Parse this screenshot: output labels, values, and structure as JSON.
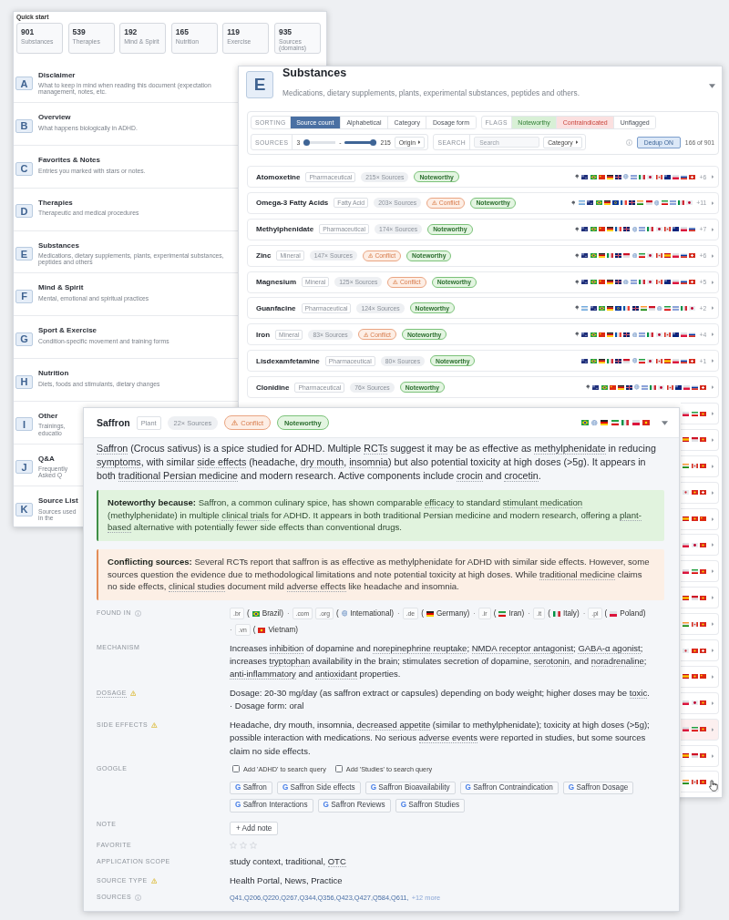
{
  "overview_window": {
    "quick_start": {
      "title": "Quick start",
      "stats": [
        {
          "value": "901",
          "label": "Substances"
        },
        {
          "value": "539",
          "label": "Therapies"
        },
        {
          "value": "192",
          "label": "Mind & Spirit"
        },
        {
          "value": "165",
          "label": "Nutrition"
        },
        {
          "value": "119",
          "label": "Exercise"
        },
        {
          "value": "935",
          "label": "Sources (domains)"
        }
      ]
    },
    "sections": [
      {
        "letter": "A",
        "title": "Disclaimer",
        "description": "What to keep in mind when reading this document (expectation management, notes, etc."
      },
      {
        "letter": "B",
        "title": "Overview",
        "description": "What happens biologically in ADHD."
      },
      {
        "letter": "C",
        "title": "Favorites & Notes",
        "description": "Entries you marked with stars or notes."
      },
      {
        "letter": "D",
        "title": "Therapies",
        "description": "Therapeutic and medical procedures"
      },
      {
        "letter": "E",
        "title": "Substances",
        "description": "Medications, dietary supplements, plants, experimental substances, peptides and others"
      },
      {
        "letter": "F",
        "title": "Mind & Spirit",
        "description": "Mental, emotional and spiritual practices"
      },
      {
        "letter": "G",
        "title": "Sport & Exercise",
        "description": "Condition-specific movement and training forms"
      },
      {
        "letter": "H",
        "title": "Nutrition",
        "description": "Diets, foods and stimulants, dietary changes"
      },
      {
        "letter": "I",
        "title": "Other",
        "description": "Trainings, educatio"
      },
      {
        "letter": "J",
        "title": "Q&A",
        "description": "Frequently Asked Q"
      },
      {
        "letter": "K",
        "title": "Source List",
        "description": "Sources used in the"
      }
    ]
  },
  "substances_window": {
    "letter": "E",
    "title": "Substances",
    "description": "Medications, dietary supplements, plants, experimental substances, peptides and others.",
    "filters": {
      "sorting": {
        "label": "SORTING",
        "options": [
          {
            "label": "Source count",
            "selected": true
          },
          {
            "label": "Alphabetical",
            "selected": false
          },
          {
            "label": "Category",
            "selected": false
          },
          {
            "label": "Dosage form",
            "selected": false
          }
        ]
      },
      "flags": {
        "label": "FLAGS",
        "options": [
          {
            "label": "Noteworthy",
            "kind": "noteworthy"
          },
          {
            "label": "Contraindicated",
            "kind": "contraindicated"
          },
          {
            "label": "Unflagged",
            "kind": "unflagged"
          }
        ]
      },
      "sources": {
        "label": "SOURCES",
        "min": {
          "value": "3",
          "level": 0
        },
        "separator": "-",
        "max": {
          "value": "215",
          "level": 1
        },
        "origin": "Origin"
      },
      "search": {
        "label": "SEARCH",
        "placeholder": "Search",
        "category": "Category"
      },
      "dedup": {
        "label": "Dedup ON",
        "on": true
      },
      "count": "166 of 901"
    },
    "rows": [
      {
        "name": "Atomoxetine",
        "category": "Pharmaceutical",
        "sources": "215× Sources",
        "badges": [
          {
            "kind": "noteworthy",
            "label": "Noteworthy"
          }
        ],
        "pin": true,
        "more": "+6"
      },
      {
        "name": "Omega-3 Fatty Acids",
        "category": "Fatty Acid",
        "sources": "203× Sources",
        "badges": [
          {
            "kind": "conflict",
            "label": "Conflict"
          },
          {
            "kind": "noteworthy",
            "label": "Noteworthy"
          }
        ],
        "pin": true,
        "more": "+11"
      },
      {
        "name": "Methylphenidate",
        "category": "Pharmaceutical",
        "sources": "174× Sources",
        "badges": [
          {
            "kind": "noteworthy",
            "label": "Noteworthy"
          }
        ],
        "pin": true,
        "more": "+7"
      },
      {
        "name": "Zinc",
        "category": "Mineral",
        "sources": "147× Sources",
        "badges": [
          {
            "kind": "conflict",
            "label": "Conflict"
          },
          {
            "kind": "noteworthy",
            "label": "Noteworthy"
          }
        ],
        "pin": true,
        "more": "+6"
      },
      {
        "name": "Magnesium",
        "category": "Mineral",
        "sources": "125× Sources",
        "badges": [
          {
            "kind": "conflict",
            "label": "Conflict"
          },
          {
            "kind": "noteworthy",
            "label": "Noteworthy"
          }
        ],
        "pin": true,
        "more": "+5"
      },
      {
        "name": "Guanfacine",
        "category": "Pharmaceutical",
        "sources": "124× Sources",
        "badges": [
          {
            "kind": "noteworthy",
            "label": "Noteworthy"
          }
        ],
        "pin": true,
        "more": "+2"
      },
      {
        "name": "Iron",
        "category": "Mineral",
        "sources": "83× Sources",
        "badges": [
          {
            "kind": "conflict",
            "label": "Conflict"
          },
          {
            "kind": "noteworthy",
            "label": "Noteworthy"
          }
        ],
        "pin": true,
        "more": "+4"
      },
      {
        "name": "Lisdexamfetamine",
        "category": "Pharmaceutical",
        "sources": "80× Sources",
        "badges": [
          {
            "kind": "noteworthy",
            "label": "Noteworthy"
          }
        ],
        "pin": false,
        "more": "+1"
      },
      {
        "name": "Clonidine",
        "category": "Pharmaceutical",
        "sources": "76× Sources",
        "badges": [
          {
            "kind": "noteworthy",
            "label": "Noteworthy"
          }
        ],
        "pin": true
      }
    ],
    "covered_rows": [
      {
        "highlighted": false
      },
      {
        "highlighted": false
      },
      {
        "highlighted": false
      },
      {
        "highlighted": false
      },
      {
        "highlighted": false
      },
      {
        "highlighted": false
      },
      {
        "highlighted": false
      },
      {
        "highlighted": false
      },
      {
        "highlighted": false
      },
      {
        "highlighted": false
      },
      {
        "highlighted": false
      },
      {
        "highlighted": false
      },
      {
        "highlighted": true
      },
      {
        "highlighted": false
      },
      {
        "highlighted": false
      }
    ]
  },
  "detail_window": {
    "name": "Saffron",
    "category": "Plant",
    "sources": "22× Sources",
    "badges": [
      {
        "kind": "conflict",
        "label": "Conflict"
      },
      {
        "kind": "noteworthy",
        "label": "Noteworthy"
      }
    ],
    "summary": [
      {
        "text": "Saffron",
        "term": true
      },
      {
        "text": " (Crocus sativus) is a spice studied for ADHD. Multiple ",
        "term": false
      },
      {
        "text": "RCTs",
        "term": true
      },
      {
        "text": " suggest it may be as effective as ",
        "term": false
      },
      {
        "text": "methylphenidate",
        "term": true
      },
      {
        "text": " in reducing ",
        "term": false
      },
      {
        "text": "symptoms",
        "term": true
      },
      {
        "text": ", with similar ",
        "term": false
      },
      {
        "text": "side effects",
        "term": true
      },
      {
        "text": " (headache, ",
        "term": false
      },
      {
        "text": "dry mouth",
        "term": true
      },
      {
        "text": ", ",
        "term": false
      },
      {
        "text": "insomnia",
        "term": true
      },
      {
        "text": ") but also potential toxicity at high doses (>5g). It appears in both ",
        "term": false
      },
      {
        "text": "traditional Persian medicine",
        "term": true
      },
      {
        "text": " and modern research. Active components include ",
        "term": false
      },
      {
        "text": "crocin",
        "term": true
      },
      {
        "text": " and ",
        "term": false
      },
      {
        "text": "crocetin",
        "term": true
      },
      {
        "text": ".",
        "term": false
      }
    ],
    "callouts": [
      {
        "kind": "noteworthy",
        "segments": [
          {
            "text": "**Noteworthy because:** Saffron, a common culinary spice, has shown comparable ",
            "term": false
          },
          {
            "text": "efficacy",
            "term": true
          },
          {
            "text": " to standard ",
            "term": false
          },
          {
            "text": "stimulant medication",
            "term": true
          },
          {
            "text": " (methylphenidate) in multiple ",
            "term": false
          },
          {
            "text": "clinical trials",
            "term": true
          },
          {
            "text": " for ADHD. It appears in both traditional Persian medicine and modern research, offering a ",
            "term": false
          },
          {
            "text": "plant-based",
            "term": true
          },
          {
            "text": " alternative with potentially fewer side effects than conventional drugs.",
            "term": false
          }
        ]
      },
      {
        "kind": "conflict",
        "segments": [
          {
            "text": "**Conflicting sources:** Several RCTs report that saffron is as effective as methylphenidate for ADHD with similar side effects. However, some sources question the evidence due to methodological limitations and note potential toxicity at high doses. While ",
            "term": false
          },
          {
            "text": "traditional medicine",
            "term": true
          },
          {
            "text": " claims no side effects, ",
            "term": false
          },
          {
            "text": "clinical studies",
            "term": true
          },
          {
            "text": " document mild ",
            "term": false
          },
          {
            "text": "adverse effects",
            "term": true
          },
          {
            "text": " like headache and insomnia.",
            "term": false
          }
        ]
      }
    ],
    "details": [
      {
        "kind": "found_in",
        "label": "FOUND IN",
        "term": false,
        "warning": false,
        "info": true,
        "groups": [
          {
            "kind": "country",
            "domains": [
              ".br"
            ],
            "open": "(",
            "country": "Brazil",
            "close": ")"
          },
          {
            "kind": "global",
            "sep": "·",
            "domains": [
              ".com",
              ".org"
            ],
            "open": "(",
            "country": "International",
            "close": ")"
          },
          {
            "kind": "country",
            "sep": "·",
            "domains": [
              ".de"
            ],
            "open": "(",
            "country": "Germany",
            "close": ")"
          },
          {
            "kind": "country",
            "sep": "·",
            "domains": [
              ".ir"
            ],
            "open": "(",
            "country": "Iran",
            "close": ")"
          },
          {
            "kind": "country",
            "sep": "·",
            "domains": [
              ".it"
            ],
            "open": "(",
            "country": "Italy",
            "close": ")"
          },
          {
            "kind": "country",
            "sep": "·",
            "domains": [
              ".pl"
            ],
            "open": "(",
            "country": "Poland",
            "close": ")"
          },
          {
            "kind": "country",
            "sep": "·",
            "domains": [
              ".vn"
            ],
            "open": "(",
            "country": "Vietnam",
            "close": ")"
          }
        ]
      },
      {
        "kind": "text",
        "label": "MECHANISM",
        "term": false,
        "warning": false,
        "info": false,
        "segments": [
          {
            "text": "Increases ",
            "term": false
          },
          {
            "text": "inhibition",
            "term": true
          },
          {
            "text": " of dopamine and ",
            "term": false
          },
          {
            "text": "norepinephrine reuptake",
            "term": true
          },
          {
            "text": "; ",
            "term": false
          },
          {
            "text": "NMDA receptor antagonist",
            "term": true
          },
          {
            "text": "; ",
            "term": false
          },
          {
            "text": "GABA-α agonist",
            "term": true
          },
          {
            "text": "; increases ",
            "term": false
          },
          {
            "text": "tryptophan",
            "term": true
          },
          {
            "text": " availability in the brain; stimulates secretion of dopamine, ",
            "term": false
          },
          {
            "text": "serotonin",
            "term": true
          },
          {
            "text": ", and ",
            "term": false
          },
          {
            "text": "noradrenaline",
            "term": true
          },
          {
            "text": "; ",
            "term": false
          },
          {
            "text": "anti-inflammatory",
            "term": true
          },
          {
            "text": " and ",
            "term": false
          },
          {
            "text": "antioxidant",
            "term": true
          },
          {
            "text": " properties.",
            "term": false
          }
        ]
      },
      {
        "kind": "text",
        "label": "DOSAGE",
        "term": true,
        "warning": true,
        "info": false,
        "segments": [
          {
            "text": "Dosage: 20-30 mg/day (as saffron extract or capsules) depending on body weight; higher doses may be ",
            "term": false
          },
          {
            "text": "toxic",
            "term": true
          },
          {
            "text": ".",
            "term": false
          }
        ],
        "suffix": "· Dosage form: oral"
      },
      {
        "kind": "text",
        "label": "SIDE EFFECTS",
        "term": false,
        "warning": true,
        "info": false,
        "segments": [
          {
            "text": "Headache, dry mouth, insomnia, ",
            "term": false
          },
          {
            "text": "decreased appetite",
            "term": true
          },
          {
            "text": " (similar to methylphenidate); toxicity at high doses (>5g); possible interaction with medications. No serious ",
            "term": false
          },
          {
            "text": "adverse events",
            "term": true
          },
          {
            "text": " were reported in studies, but some sources claim no side effects.",
            "term": false
          }
        ]
      },
      {
        "kind": "google",
        "label": "GOOGLE",
        "term": false,
        "warning": false,
        "info": false,
        "options": [
          {
            "label": "Add 'ADHD' to search query",
            "checked": false
          },
          {
            "label": "Add 'Studies' to search query",
            "checked": false
          }
        ],
        "buttons": [
          {
            "mark": "G",
            "label": "Saffron"
          },
          {
            "mark": "G",
            "label": "Saffron Side effects"
          },
          {
            "mark": "G",
            "label": "Saffron Bioavailability"
          },
          {
            "mark": "G",
            "label": "Saffron Contraindication"
          },
          {
            "mark": "G",
            "label": "Saffron Dosage"
          },
          {
            "mark": "G",
            "label": "Saffron Interactions"
          },
          {
            "mark": "G",
            "label": "Saffron Reviews"
          },
          {
            "mark": "G",
            "label": "Saffron Studies"
          }
        ]
      },
      {
        "kind": "note",
        "label": "NOTE",
        "term": false,
        "warning": false,
        "info": false,
        "button": "+ Add note"
      },
      {
        "kind": "stars",
        "label": "FAVORITE",
        "term": false,
        "warning": false,
        "info": false,
        "stars": 0
      },
      {
        "kind": "text",
        "label": "APPLICATION SCOPE",
        "term": false,
        "warning": false,
        "info": false,
        "segments": [
          {
            "text": "study context, traditional, ",
            "term": false
          },
          {
            "text": "OTC",
            "term": true
          }
        ]
      },
      {
        "kind": "text",
        "label": "SOURCE TYPE",
        "term": false,
        "warning": true,
        "info": false,
        "segments": [
          {
            "text": "Health Portal, News, Practice",
            "term": false
          }
        ]
      },
      {
        "kind": "sources",
        "label": "SOURCES",
        "term": false,
        "warning": false,
        "info": true,
        "links": "Q41,Q206,Q220,Q267,Q344,Q356,Q423,Q427,Q584,Q611,",
        "more": "+12 more"
      }
    ]
  }
}
